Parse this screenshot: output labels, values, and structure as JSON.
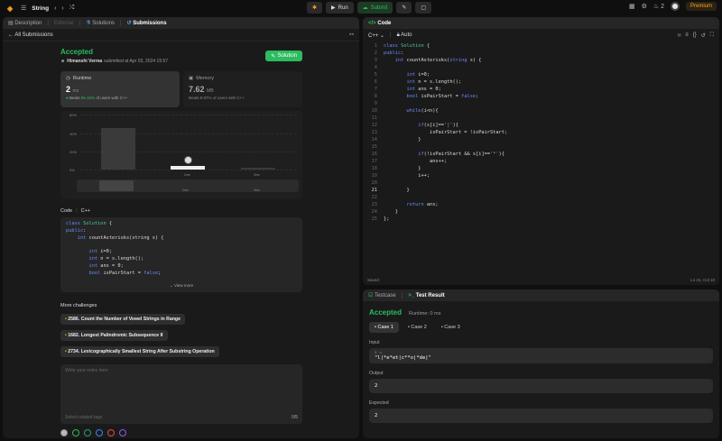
{
  "topbar": {
    "problem_list": "String",
    "run": "Run",
    "submit": "Submit",
    "streak": "2",
    "premium": "Premium"
  },
  "left": {
    "tabs": [
      "Description",
      "Editorial",
      "Solutions",
      "Submissions"
    ],
    "all_submissions": "All Submissions",
    "status": "Accepted",
    "user": "Himanshi Verma",
    "submitted": "submitted at Apr 03, 2024 15:57",
    "solution_btn": "Solution",
    "runtime": {
      "label": "Runtime",
      "value": "2",
      "unit": "ms",
      "beats_prefix": "Beats",
      "beats": "55.16%",
      "beats_suffix": "of users with C++"
    },
    "memory": {
      "label": "Memory",
      "value": "7.62",
      "unit": "MB",
      "beats_prefix": "Beats",
      "beats": "8.87%",
      "beats_suffix": "of users with C++"
    },
    "chart_ylabels": [
      "60%",
      "40%",
      "20%",
      "0%"
    ],
    "chart_xlabels": [
      "2ms",
      "3ms",
      "2ms",
      "3ms"
    ],
    "code_label": "Code",
    "code_lang": "C++",
    "code_preview": [
      "class Solution {",
      "public:",
      "    int countAsterisks(string s) {",
      "",
      "        int i=0;",
      "        int n = s.length();",
      "        int ans = 0;",
      "        bool isPairStart = false;"
    ],
    "view_more": "View more",
    "more_label": "More challenges",
    "challenges": [
      "2586. Count the Number of Vowel Strings in Range",
      "1682. Longest Palindromic Subsequence II",
      "2734. Lexicographically Smallest String After Substring Operation"
    ],
    "notes_placeholder": "Write your notes here",
    "tags_placeholder": "Select related tags",
    "notes_count": "0/5"
  },
  "code": {
    "title": "Code",
    "lang": "C++",
    "auto": "Auto",
    "saved": "Saved",
    "cursor": "Ln 21, Col 10"
  },
  "test": {
    "tab1": "Testcase",
    "tab2": "Test Result",
    "status": "Accepted",
    "runtime": "Runtime: 0 ms",
    "cases": [
      "Case 1",
      "Case 2",
      "Case 3"
    ],
    "input_label": "Input",
    "input_key": "s =",
    "input_value": "\"l|*e*et|c**o|*de|\"",
    "output_label": "Output",
    "output_value": "2",
    "expected_label": "Expected",
    "expected_value": "2"
  },
  "chart_data": {
    "type": "bar",
    "categories": [
      "2ms",
      "3ms"
    ],
    "values": [
      45,
      4
    ],
    "ylim": [
      0,
      60
    ]
  },
  "colors": {
    "accent": "#2cbb5d",
    "brand": "#ffa116"
  }
}
